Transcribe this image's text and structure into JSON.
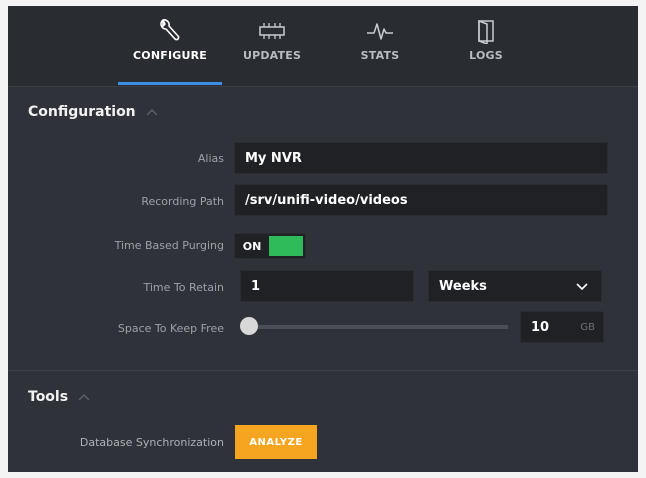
{
  "nav": {
    "tabs": [
      {
        "label": "CONFIGURE",
        "icon": "wrench-icon",
        "active": true
      },
      {
        "label": "UPDATES",
        "icon": "chip-icon",
        "active": false
      },
      {
        "label": "STATS",
        "icon": "pulse-icon",
        "active": false
      },
      {
        "label": "LOGS",
        "icon": "door-icon",
        "active": false
      }
    ]
  },
  "configuration": {
    "title": "Configuration",
    "alias": {
      "label": "Alias",
      "value": "My NVR"
    },
    "recording_path": {
      "label": "Recording Path",
      "value": "/srv/unifi-video/videos"
    },
    "time_based_purging": {
      "label": "Time Based Purging",
      "state": "ON"
    },
    "time_to_retain": {
      "label": "Time To Retain",
      "value": "1",
      "unit": "Weeks"
    },
    "space_to_keep_free": {
      "label": "Space To Keep Free",
      "value": "10",
      "unit": "GB",
      "slider_level": 0
    }
  },
  "tools": {
    "title": "Tools",
    "db_sync": {
      "label": "Database Synchronization",
      "button": "ANALYZE"
    }
  },
  "colors": {
    "accent": "#3c8ee6",
    "toggle_on": "#2fbb5a",
    "analyze": "#f5a51f"
  }
}
